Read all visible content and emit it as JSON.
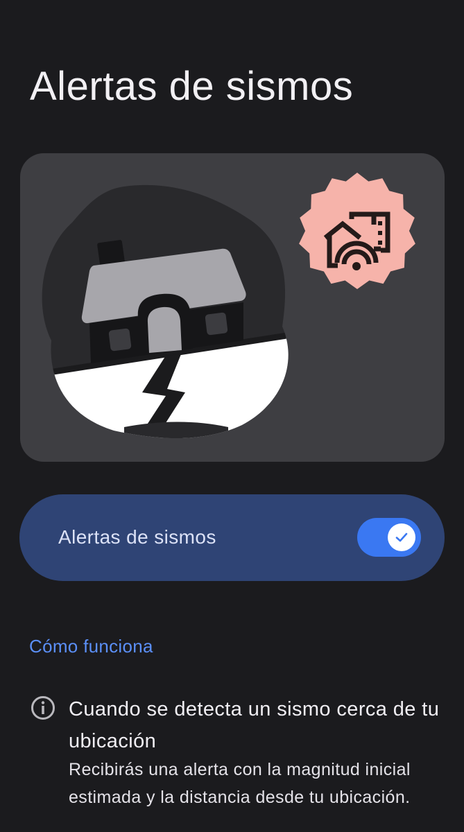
{
  "page": {
    "title": "Alertas de sismos"
  },
  "illustration": {
    "house_icon": "house-shaking-icon",
    "alert_badge_icon": "home-alert-signal-icon",
    "colors": {
      "card": "#3e3e42",
      "blob": "#29292c",
      "house_roof": "#a7a6ab",
      "badge": "#f6b3aa"
    }
  },
  "toggle": {
    "label": "Alertas de sismos",
    "checked": true,
    "check_icon": "check-icon",
    "colors": {
      "card": "#2f4475",
      "track": "#3a78f2"
    }
  },
  "how_it_works": {
    "link_label": "Cómo funciona"
  },
  "info": {
    "icon": "info-icon",
    "title": "Cuando se detecta un sismo cerca de tu ubicación",
    "body": "Recibirás una alerta con la magnitud inicial estimada y la distancia desde tu ubicación."
  }
}
